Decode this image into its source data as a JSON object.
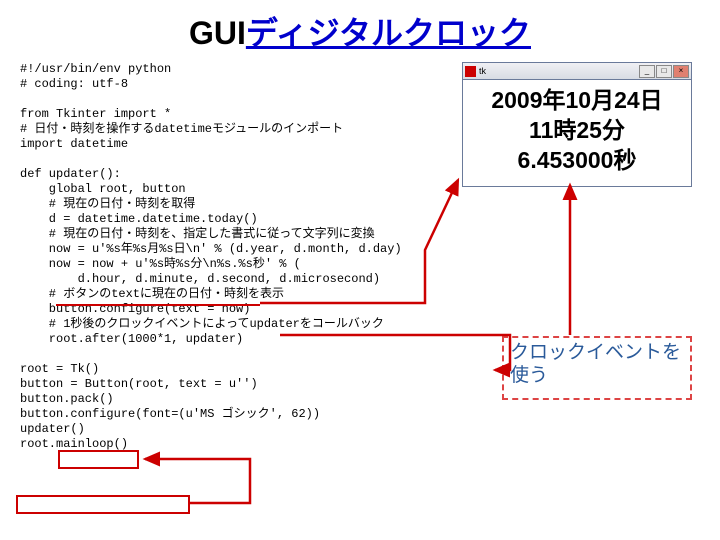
{
  "title": {
    "plain": "GUI",
    "link": "ディジタルクロック"
  },
  "code": {
    "l0": "#!/usr/bin/env python",
    "l1": "# coding: utf-8",
    "l2": "",
    "l3": "from Tkinter import *",
    "l4": "# 日付・時刻を操作するdatetimeモジュールのインポート",
    "l5": "import datetime",
    "l6": "",
    "l7": "def updater():",
    "l8": "    global root, button",
    "l9": "    # 現在の日付・時刻を取得",
    "l10": "    d = datetime.datetime.today()",
    "l11": "    # 現在の日付・時刻を、指定した書式に従って文字列に変換",
    "l12": "    now = u'%s年%s月%s日\\n' % (d.year, d.month, d.day)",
    "l13": "    now = now + u'%s時%s分\\n%s.%s秒' % (",
    "l14": "        d.hour, d.minute, d.second, d.microsecond)",
    "l15": "    # ボタンのtextに現在の日付・時刻を表示",
    "l16": "    button.configure(text = now)",
    "l17": "    # 1秒後のクロックイベントによってupdaterをコールバック",
    "l18": "    root.after(1000*1, updater)",
    "l19": "",
    "l20": "root = Tk()",
    "l21": "button = Button(root, text = u'')",
    "l22": "button.pack()",
    "l23": "button.configure(font=(u'MS ゴシック', 62))",
    "l24": "updater()",
    "l25": "root.mainloop()"
  },
  "window": {
    "title": "tk",
    "min": "_",
    "max": "□",
    "close": "×",
    "line1": "2009年10月24日",
    "line2": "11時25分",
    "line3": "6.453000秒"
  },
  "callout": "クロックイベントを使う"
}
